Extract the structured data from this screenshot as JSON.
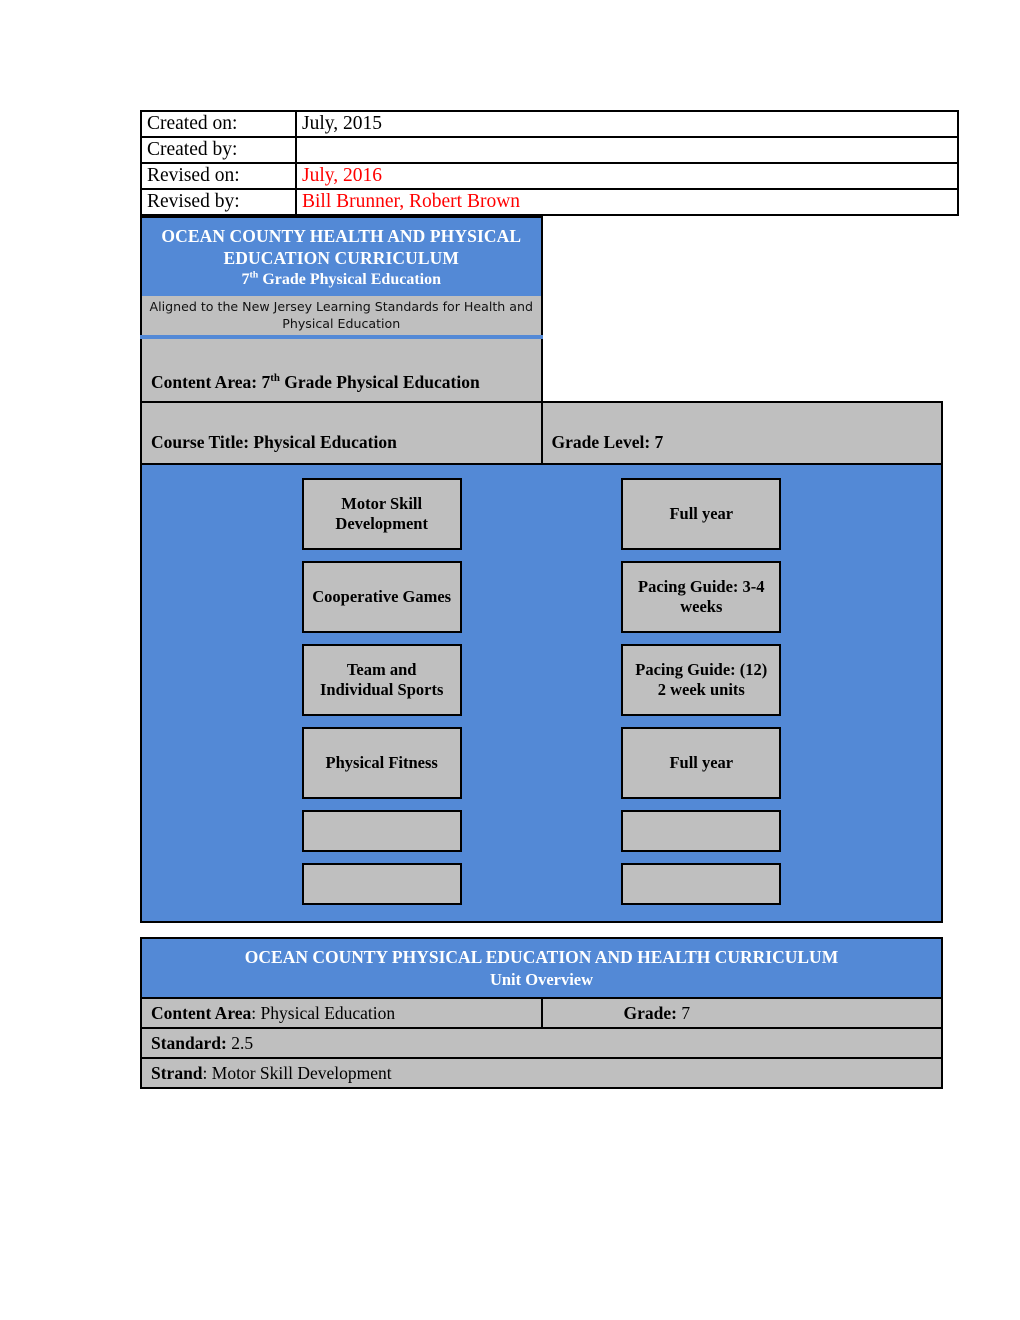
{
  "document": {
    "meta_rows": [
      {
        "label": "Created on:",
        "value": "July, 2015",
        "red": false
      },
      {
        "label": "Created by:",
        "value": "",
        "red": false
      },
      {
        "label": "Revised on:",
        "value": "July, 2016",
        "red": true
      },
      {
        "label": "Revised by:",
        "value": "Bill Brunner, Robert Brown",
        "red": true
      }
    ],
    "banner": {
      "line1": "OCEAN COUNTY HEALTH AND PHYSICAL EDUCATION CURRICULUM",
      "line2_prefix": "7",
      "line2_sup": "th",
      "line2_suffix": " Grade Physical Education",
      "aligned_note": "Aligned to the New Jersey Learning Standards for Health and Physical Education"
    },
    "content_area": {
      "label": "Content Area: 7",
      "sup": "th",
      "suffix": " Grade Physical Education"
    },
    "course": {
      "title": "Course Title: Physical Education",
      "grade_level": "Grade Level: 7"
    },
    "unit_grid": [
      {
        "unit": "Motor Skill Development",
        "pacing": "Full year"
      },
      {
        "unit": "Cooperative Games",
        "pacing": "Pacing Guide: 3-4 weeks"
      },
      {
        "unit": "Team and Individual Sports",
        "pacing": "Pacing Guide: (12) 2 week units"
      },
      {
        "unit": "Physical Fitness",
        "pacing": "Full year"
      },
      {
        "unit": "",
        "pacing": ""
      },
      {
        "unit": "",
        "pacing": ""
      }
    ],
    "unit_overview": {
      "banner_line1": "OCEAN COUNTY PHYSICAL EDUCATION AND HEALTH CURRICULUM",
      "banner_line2": "Unit Overview",
      "content_area_label": "Content Area",
      "content_area_value": ":  Physical Education",
      "grade_label": "Grade:",
      "grade_value": " 7",
      "standard_label": "Standard:",
      "standard_value": "  2.5",
      "strand_label": "Strand",
      "strand_value": ": Motor Skill Development"
    }
  },
  "colors": {
    "blue": "#5389D6",
    "gray": "#BFBFBF",
    "red": "#FF0000",
    "black": "#000000",
    "white": "#FFFFFF"
  }
}
